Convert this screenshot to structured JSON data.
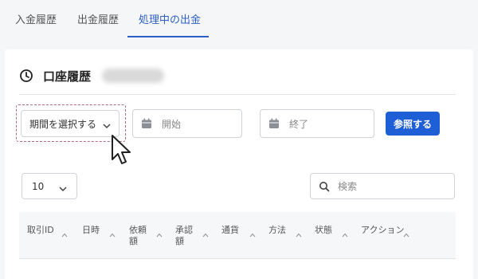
{
  "tabs": [
    {
      "label": "入金履歴"
    },
    {
      "label": "出金履歴"
    },
    {
      "label": "処理中の出金"
    }
  ],
  "card": {
    "title": "口座履歴"
  },
  "filters": {
    "period_select": "期間を選択する",
    "start_placeholder": "開始",
    "end_placeholder": "終了",
    "submit_label": "参照する"
  },
  "table_controls": {
    "page_size": "10",
    "search_placeholder": "検索"
  },
  "table": {
    "columns": [
      {
        "label": "取引ID"
      },
      {
        "label": "日時"
      },
      {
        "label": "依頼\n額"
      },
      {
        "label": "承認\n額"
      },
      {
        "label": "通貨"
      },
      {
        "label": "方法"
      },
      {
        "label": "状態"
      },
      {
        "label": "アクション"
      }
    ]
  },
  "colors": {
    "accent": "#1f5fd6",
    "active_tab": "#2c5fc5",
    "highlight_border": "#b06a7a"
  },
  "icons": {
    "header": "clock-icon",
    "date": "calendar-icon",
    "search": "search-icon",
    "dropdown": "chevron-down-icon",
    "sort": "sort-up-icon"
  }
}
